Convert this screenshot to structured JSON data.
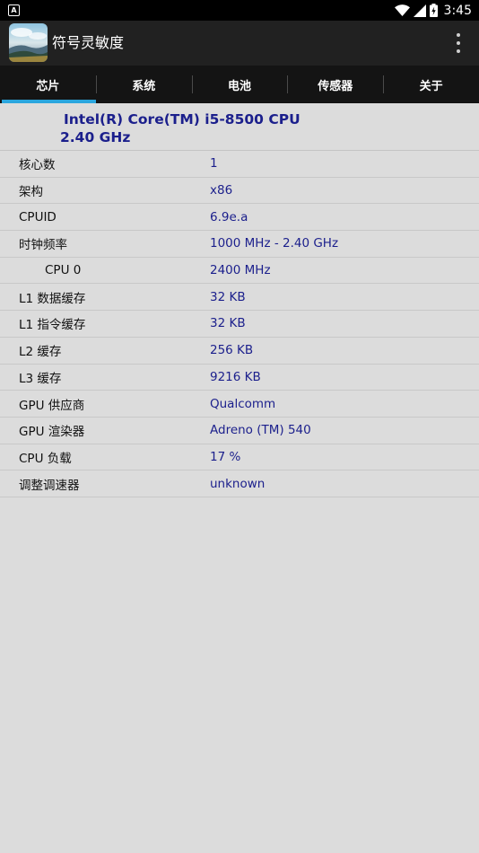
{
  "status_bar": {
    "time": "3:45",
    "notification_icon_letter": "A",
    "icons": [
      "wifi-icon",
      "cell-signal-icon",
      "battery-icon"
    ]
  },
  "app_bar": {
    "title": "符号灵敏度",
    "icon": "app-landscape-icon",
    "menu_icon": "overflow-menu-icon"
  },
  "tabs": [
    {
      "label": "芯片",
      "active": true
    },
    {
      "label": "系统",
      "active": false
    },
    {
      "label": "电池",
      "active": false
    },
    {
      "label": "传感器",
      "active": false
    },
    {
      "label": "关于",
      "active": false
    }
  ],
  "cpu": {
    "name_line1": "Intel(R) Core(TM) i5-8500 CPU",
    "name_line2": "2.40 GHz"
  },
  "rows": [
    {
      "label": "核心数",
      "value": "1"
    },
    {
      "label": "架构",
      "value": "x86"
    },
    {
      "label": "CPUID",
      "value": "6.9e.a"
    },
    {
      "label": "时钟频率",
      "value": "1000 MHz - 2.40 GHz"
    },
    {
      "label": "CPU 0",
      "value": "2400 MHz"
    },
    {
      "label": "L1 数据缓存",
      "value": "32 KB"
    },
    {
      "label": "L1 指令缓存",
      "value": "32 KB"
    },
    {
      "label": "L2 缓存",
      "value": "256 KB"
    },
    {
      "label": "L3 缓存",
      "value": "9216 KB"
    },
    {
      "label": "GPU 供应商",
      "value": "Qualcomm"
    },
    {
      "label": "GPU 渲染器",
      "value": "Adreno (TM) 540"
    },
    {
      "label": "CPU 负载",
      "value": "17 %"
    },
    {
      "label": "调整调速器",
      "value": "unknown"
    }
  ],
  "colors": {
    "status_bar": "#000000",
    "app_bar": "#212121",
    "tab_bar": "#141414",
    "tab_indicator": "#2ba6de",
    "background": "#dcdcdc",
    "value_text": "#1b1f8c"
  }
}
